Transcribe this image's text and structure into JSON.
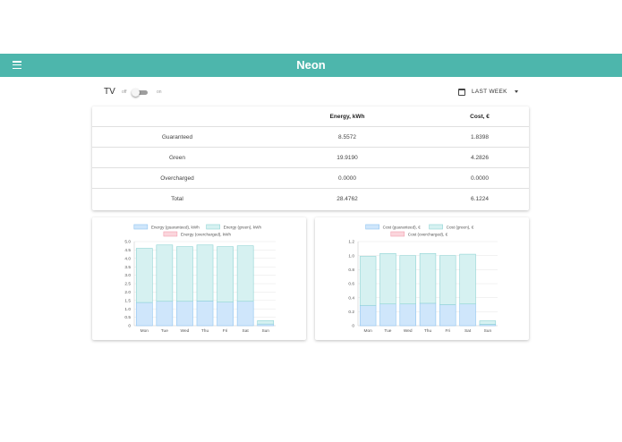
{
  "app": {
    "title": "Neon"
  },
  "device": {
    "name": "TV",
    "off_label": "off",
    "on_label": "on"
  },
  "period": {
    "label": "LAST WEEK"
  },
  "summary": {
    "headers": [
      "",
      "Energy, kWh",
      "Cost, €"
    ],
    "rows": [
      [
        "Guaranteed",
        "8.5572",
        "1.8398"
      ],
      [
        "Green",
        "19.9190",
        "4.2826"
      ],
      [
        "Overcharged",
        "0.0000",
        "0.0000"
      ],
      [
        "Total",
        "28.4762",
        "6.1224"
      ]
    ]
  },
  "colors": {
    "accent": "#4db6ac",
    "guaranteed": "#cfe6fb",
    "green": "#d6f1f1",
    "overcharged": "#fbd5dc"
  },
  "chart_data": [
    {
      "type": "bar",
      "stacked": true,
      "categories": [
        "Mon",
        "Tue",
        "Wed",
        "Thu",
        "Fri",
        "Sat",
        "Sun"
      ],
      "series": [
        {
          "name": "Energy (guaranteed), kWh",
          "values": [
            1.38,
            1.45,
            1.45,
            1.47,
            1.4,
            1.45,
            0.1
          ],
          "color": "#cfe6fb",
          "stroke": "#8ec4f0"
        },
        {
          "name": "Energy (green), kWh",
          "values": [
            3.22,
            3.35,
            3.25,
            3.33,
            3.3,
            3.3,
            0.2
          ],
          "color": "#d6f1f1",
          "stroke": "#8fd4d4"
        },
        {
          "name": "Energy (overcharged), kWh",
          "values": [
            0,
            0,
            0,
            0,
            0,
            0,
            0
          ],
          "color": "#fbd5dc",
          "stroke": "#f2a0b0"
        }
      ],
      "ylim": [
        0,
        5
      ],
      "yticks": [
        "0",
        "0.5",
        "1.0",
        "1.5",
        "2.0",
        "2.5",
        "3.0",
        "3.5",
        "4.0",
        "4.5",
        "5.0"
      ],
      "legend": "top"
    },
    {
      "type": "bar",
      "stacked": true,
      "categories": [
        "Mon",
        "Tue",
        "Wed",
        "Thu",
        "Fri",
        "Sat",
        "Sun"
      ],
      "series": [
        {
          "name": "Cost (guaranteed), €",
          "values": [
            0.29,
            0.31,
            0.31,
            0.32,
            0.3,
            0.31,
            0.02
          ],
          "color": "#cfe6fb",
          "stroke": "#8ec4f0"
        },
        {
          "name": "Cost (green), €",
          "values": [
            0.7,
            0.72,
            0.69,
            0.71,
            0.7,
            0.71,
            0.05
          ],
          "color": "#d6f1f1",
          "stroke": "#8fd4d4"
        },
        {
          "name": "Cost (overcharged), €",
          "values": [
            0,
            0,
            0,
            0,
            0,
            0,
            0
          ],
          "color": "#fbd5dc",
          "stroke": "#f2a0b0"
        }
      ],
      "ylim": [
        0,
        1.2
      ],
      "yticks": [
        "0",
        "0.2",
        "0.4",
        "0.6",
        "0.8",
        "1.0",
        "1.2"
      ],
      "legend": "top"
    }
  ]
}
